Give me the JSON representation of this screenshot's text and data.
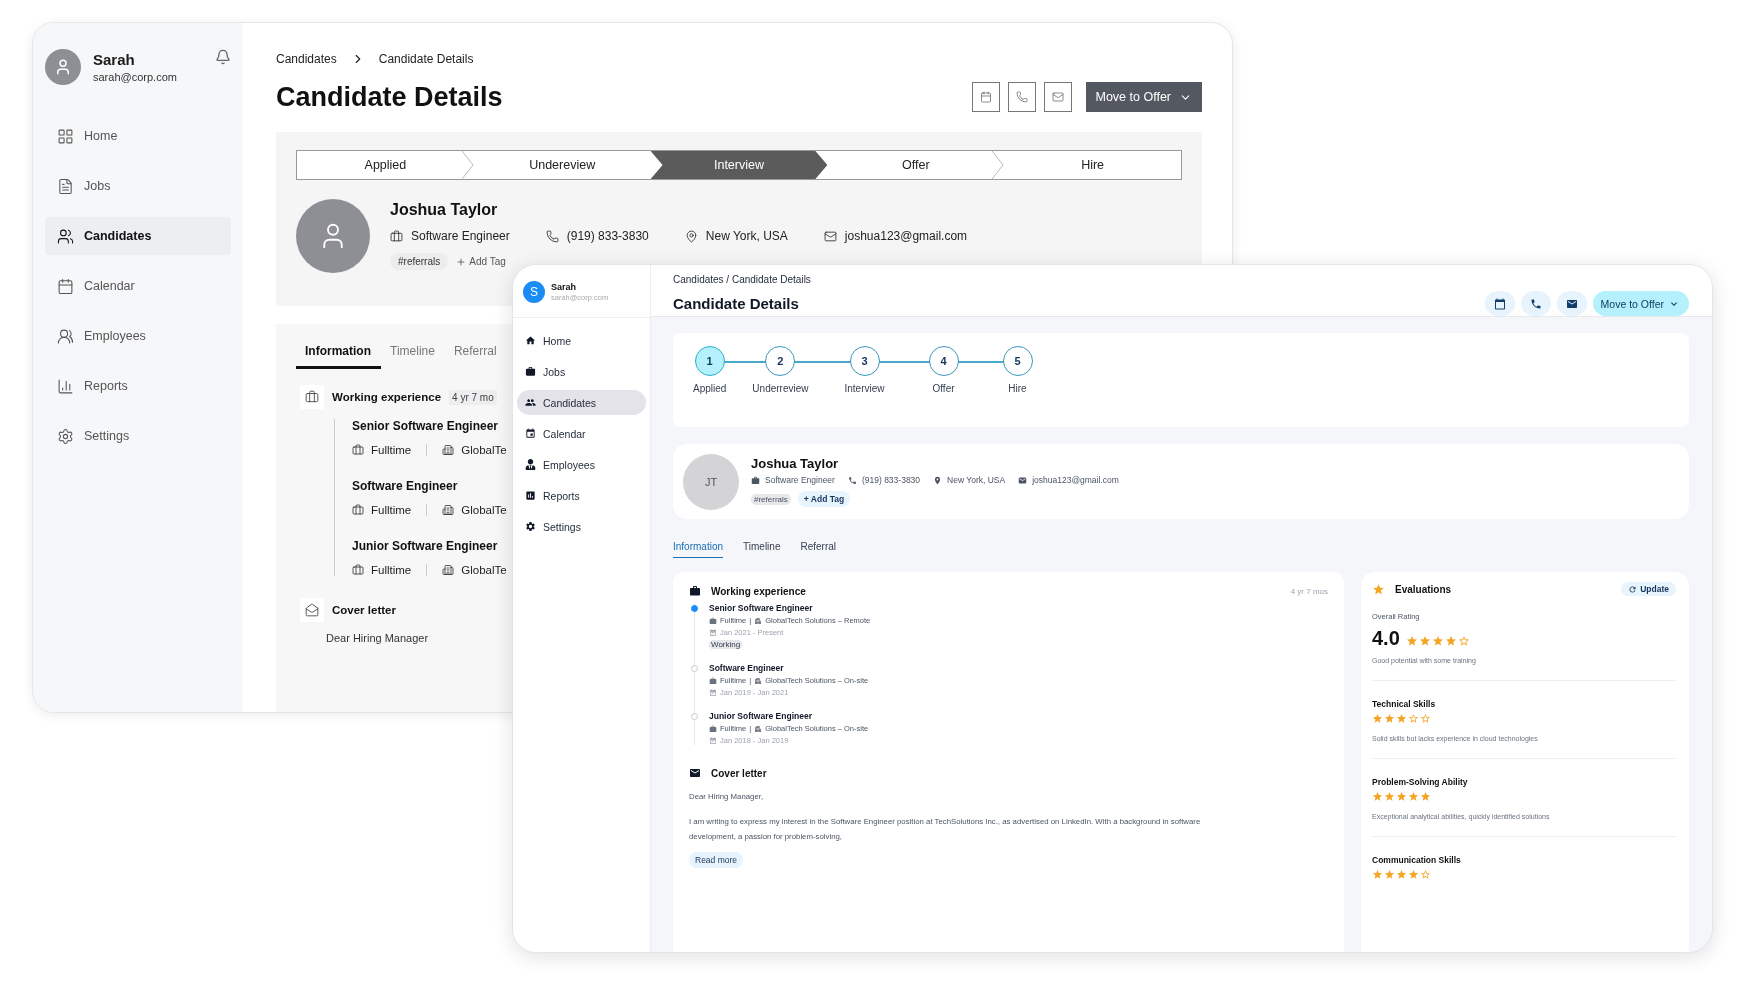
{
  "back_window": {
    "user": {
      "name": "Sarah",
      "email": "sarah@corp.com"
    },
    "nav": [
      {
        "label": "Home",
        "selected": false
      },
      {
        "label": "Jobs",
        "selected": false
      },
      {
        "label": "Candidates",
        "selected": true
      },
      {
        "label": "Calendar",
        "selected": false
      },
      {
        "label": "Employees",
        "selected": false
      },
      {
        "label": "Reports",
        "selected": false
      },
      {
        "label": "Settings",
        "selected": false
      }
    ],
    "breadcrumb": [
      "Candidates",
      "Candidate Details"
    ],
    "title": "Candidate Details",
    "primary_action": "Move to Offer",
    "pipeline": [
      {
        "label": "Applied",
        "selected": false
      },
      {
        "label": "Undereview",
        "selected": false
      },
      {
        "label": "Interview",
        "selected": true
      },
      {
        "label": "Offer",
        "selected": false
      },
      {
        "label": "Hire",
        "selected": false
      }
    ],
    "candidate": {
      "name": "Joshua Taylor",
      "details": [
        {
          "kind": "role",
          "text": "Software Engineer"
        },
        {
          "kind": "phone",
          "text": "(919) 833-3830"
        },
        {
          "kind": "location",
          "text": "New York, USA"
        },
        {
          "kind": "email",
          "text": "joshua123@gmail.com"
        }
      ],
      "tags": [
        "#referrals"
      ],
      "add_tag": "Add Tag"
    },
    "tabs": [
      {
        "label": "Information",
        "selected": true
      },
      {
        "label": "Timeline",
        "selected": false
      },
      {
        "label": "Referral",
        "selected": false
      }
    ],
    "experience": {
      "title": "Working experience",
      "duration": "4 yr 7 mo",
      "items": [
        {
          "title": "Senior Software Engineer",
          "type": "Fulltime",
          "company": "GlobalTe"
        },
        {
          "title": "Software Engineer",
          "type": "Fulltime",
          "company": "GlobalTe"
        },
        {
          "title": "Junior Software Engineer",
          "type": "Fulltime",
          "company": "GlobalTe"
        }
      ]
    },
    "cover_letter": {
      "title": "Cover letter",
      "text": "Dear Hiring Manager"
    }
  },
  "front_window": {
    "user": {
      "initial": "S",
      "name": "Sarah",
      "email": "sarah@corp.com"
    },
    "nav": [
      {
        "label": "Home",
        "selected": false
      },
      {
        "label": "Jobs",
        "selected": false
      },
      {
        "label": "Candidates",
        "selected": true
      },
      {
        "label": "Calendar",
        "selected": false
      },
      {
        "label": "Employees",
        "selected": false
      },
      {
        "label": "Reports",
        "selected": false
      },
      {
        "label": "Settings",
        "selected": false
      }
    ],
    "breadcrumb": "Candidates / Candidate Details",
    "title": "Candidate Details",
    "primary_action": "Move to Offer",
    "steps": [
      {
        "number": "1",
        "label": "Applied",
        "selected": true
      },
      {
        "number": "2",
        "label": "Underreview",
        "selected": false
      },
      {
        "number": "3",
        "label": "Interview",
        "selected": false
      },
      {
        "number": "4",
        "label": "Offer",
        "selected": false
      },
      {
        "number": "5",
        "label": "Hire",
        "selected": false
      }
    ],
    "candidate": {
      "initials": "JT",
      "name": "Joshua Taylor",
      "details": [
        {
          "kind": "role",
          "text": "Software Engineer"
        },
        {
          "kind": "phone",
          "text": "(919) 833-3830"
        },
        {
          "kind": "location",
          "text": "New York, USA"
        },
        {
          "kind": "email",
          "text": "joshua123@gmail.com"
        }
      ],
      "tags": [
        "#referrals"
      ],
      "add_tag": "+ Add Tag"
    },
    "tabs": [
      {
        "label": "Information",
        "selected": true
      },
      {
        "label": "Timeline",
        "selected": false
      },
      {
        "label": "Referral",
        "selected": false
      }
    ],
    "experience": {
      "title": "Working experience",
      "duration": "4 yr 7 mos",
      "items": [
        {
          "title": "Senior Software Engineer",
          "type": "Fulltime",
          "separator": "|",
          "company": "GlobalTech Solutions – Remote",
          "dates": "Jan 2021 - Present",
          "current": true,
          "badge": "Working"
        },
        {
          "title": "Software Engineer",
          "type": "Fulltime",
          "separator": "|",
          "company": "GlobalTech Solutions – On-site",
          "dates": "Jan 2019 - Jan 2021",
          "current": false
        },
        {
          "title": "Junior Software Engineer",
          "type": "Fulltime",
          "separator": "|",
          "company": "GlobalTech Solutions – On-site",
          "dates": "Jan 2018 - Jan 2019",
          "current": false
        }
      ]
    },
    "cover_letter": {
      "title": "Cover letter",
      "greeting": "Dear Hiring Manager,",
      "body": "I am writing to express my interest in the Software Engineer position at TechSolutions Inc., as advertised on LinkedIn. With a background in software development, a passion for problem-solving,",
      "read_more": "Read more"
    },
    "evaluations": {
      "title": "Evaluations",
      "update": "Update",
      "overall": {
        "label": "Overall Rating",
        "score": "4.0",
        "stars": 4,
        "note": "Good potential with some training"
      },
      "criteria": [
        {
          "name": "Technical Skills",
          "stars": 3,
          "note": "Solid skills but lacks experience in cloud technologies"
        },
        {
          "name": "Problem-Solving Ability",
          "stars": 5,
          "note": "Exceptional analytical abilities, quickly identified solutions"
        },
        {
          "name": "Communication Skills",
          "stars": 4
        }
      ]
    }
  }
}
